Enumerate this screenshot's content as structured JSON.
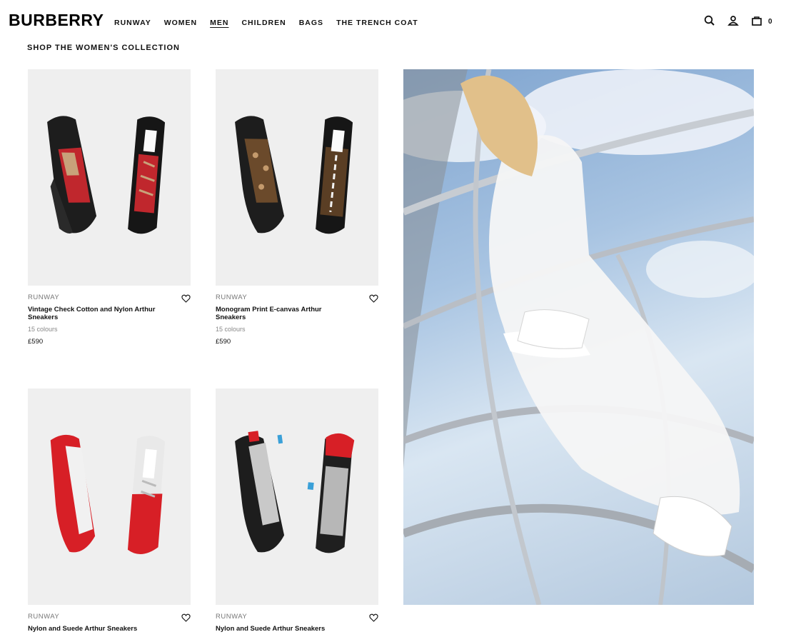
{
  "header": {
    "logo": "BURBERRY",
    "nav": [
      {
        "label": "RUNWAY",
        "active": false
      },
      {
        "label": "WOMEN",
        "active": false
      },
      {
        "label": "MEN",
        "active": true
      },
      {
        "label": "CHILDREN",
        "active": false
      },
      {
        "label": "BAGS",
        "active": false
      },
      {
        "label": "THE TRENCH COAT",
        "active": false
      }
    ],
    "icons": [
      "search-icon",
      "account-icon",
      "bag-icon"
    ],
    "bag_count": "0"
  },
  "section_title": "SHOP THE WOMEN'S COLLECTION",
  "products": [
    {
      "label": "RUNWAY",
      "name": "Vintage Check Cotton and Nylon Arthur Sneakers",
      "colours": "15 colours",
      "price": "£590",
      "accent": "#c0272d"
    },
    {
      "label": "RUNWAY",
      "name": "Monogram Print E-canvas Arthur Sneakers",
      "colours": "15 colours",
      "price": "£590",
      "accent": "#6b4a2b"
    },
    {
      "label": "RUNWAY",
      "name": "Nylon and Suede Arthur Sneakers",
      "accent": "#d71f26"
    },
    {
      "label": "RUNWAY",
      "name": "Nylon and Suede Arthur Sneakers",
      "accent": "#2a2a2a"
    }
  ],
  "colors": {
    "text": "#111111",
    "muted": "#777777",
    "tile_bg": "#efefef"
  }
}
